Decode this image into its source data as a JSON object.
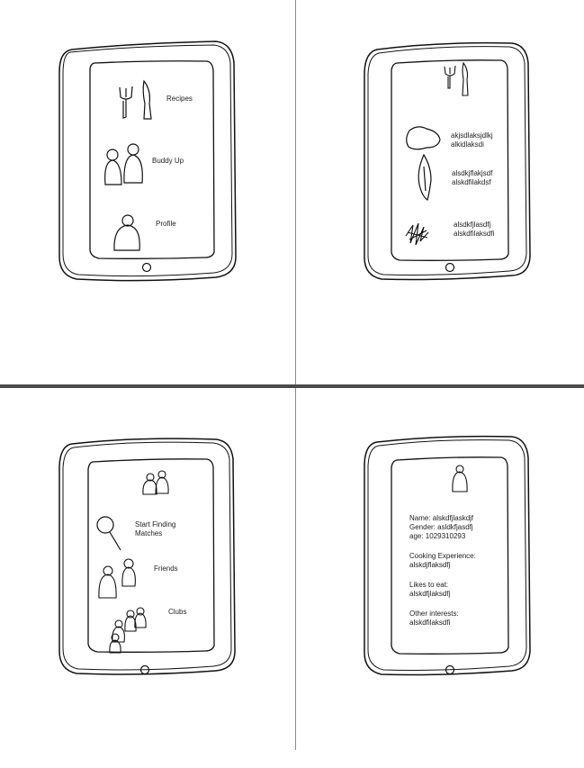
{
  "home": {
    "items": [
      {
        "label": "Recipes",
        "icon": "utensils-icon"
      },
      {
        "label": "Buddy Up",
        "icon": "two-people-icon"
      },
      {
        "label": "Profile",
        "icon": "person-icon"
      }
    ]
  },
  "recipes": {
    "header_icon": "utensils-icon",
    "items": [
      {
        "line1": "akjsdlaksjdlkj",
        "line2": "alkidlaksdi",
        "icon": "meat-icon"
      },
      {
        "line1": "alsdkjflakjsdf",
        "line2": "alskdfilakdsf",
        "icon": "fish-icon"
      },
      {
        "line1": "alsdkfjlasdfj",
        "line2": "alskdfilaksdfi",
        "icon": "scribble-food-icon"
      }
    ]
  },
  "buddy": {
    "header_icon": "two-people-icon",
    "items": [
      {
        "label": "Start Finding\nMatches",
        "icon": "magnifier-icon"
      },
      {
        "label": "Friends",
        "icon": "two-people-icon"
      },
      {
        "label": "Clubs",
        "icon": "group-icon"
      }
    ]
  },
  "profile": {
    "header_icon": "person-icon",
    "name": "Name: alskdfjlaskdjf",
    "gender": "Gender: asldkfjasdfj",
    "age": "age: 1029310293",
    "cooking_label": "Cooking Experience:",
    "cooking_value": "alskdjflaksdfj",
    "likes_label": "Likes to eat:",
    "likes_value": "alskdfjlaksdfj",
    "other_label": "Other interests:",
    "other_value": "alskdfilaksdfi"
  }
}
